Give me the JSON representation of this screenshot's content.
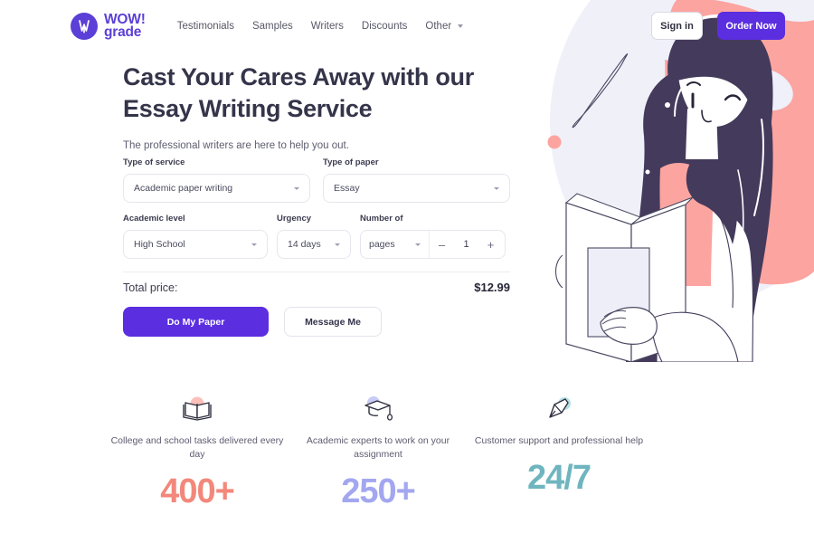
{
  "brand": {
    "logo_icon": "wowgrade-w-circle-icon",
    "name_line1": "WOW!",
    "name_line2": "grade",
    "purple": "#5b3fd6",
    "accent_purple": "#5b2ee0"
  },
  "nav": {
    "items": [
      {
        "label": "Testimonials",
        "has_caret": false
      },
      {
        "label": "Samples",
        "has_caret": false
      },
      {
        "label": "Writers",
        "has_caret": false
      },
      {
        "label": "Discounts",
        "has_caret": false
      },
      {
        "label": "Other",
        "has_caret": true
      }
    ]
  },
  "header": {
    "sign_in_label": "Sign in",
    "order_now_label": "Order Now"
  },
  "hero": {
    "headline": "Cast Your Cares Away with our Essay Writing Service",
    "subhead": "The professional writers are here to help you out."
  },
  "form": {
    "type_of_service": {
      "label": "Type of service",
      "value": "Academic paper writing"
    },
    "type_of_paper": {
      "label": "Type of paper",
      "value": "Essay"
    },
    "academic_level": {
      "label": "Academic level",
      "value": "High School"
    },
    "urgency": {
      "label": "Urgency",
      "value": "14 days"
    },
    "number_of": {
      "label": "Number of",
      "unit": "pages",
      "quantity": "1",
      "minus_label": "–",
      "plus_label": "+"
    },
    "total_price_label": "Total price:",
    "total_price_value": "$12.99",
    "do_my_paper_label": "Do My Paper",
    "message_me_label": "Message Me"
  },
  "stats": [
    {
      "icon": "open-book-icon",
      "text": "College and school tasks delivered every day",
      "number": "400+",
      "color": "#f2887b"
    },
    {
      "icon": "graduation-cap-icon",
      "text": "Academic experts to work on your assignment",
      "number": "250+",
      "color": "#a3a7f0"
    },
    {
      "icon": "fountain-pen-nib-icon",
      "text": "Customer support and professional help",
      "number": "24/7",
      "color": "#6fb5bf"
    }
  ],
  "illustration": {
    "name": "girl-reading-book-illustration",
    "bg_lavender": "#f0f0f9",
    "shape_pink": "#fca4a0",
    "hair_dark": "#443a5c",
    "skin_white": "#ffffff",
    "blouse_pink": "#fca4a0"
  }
}
